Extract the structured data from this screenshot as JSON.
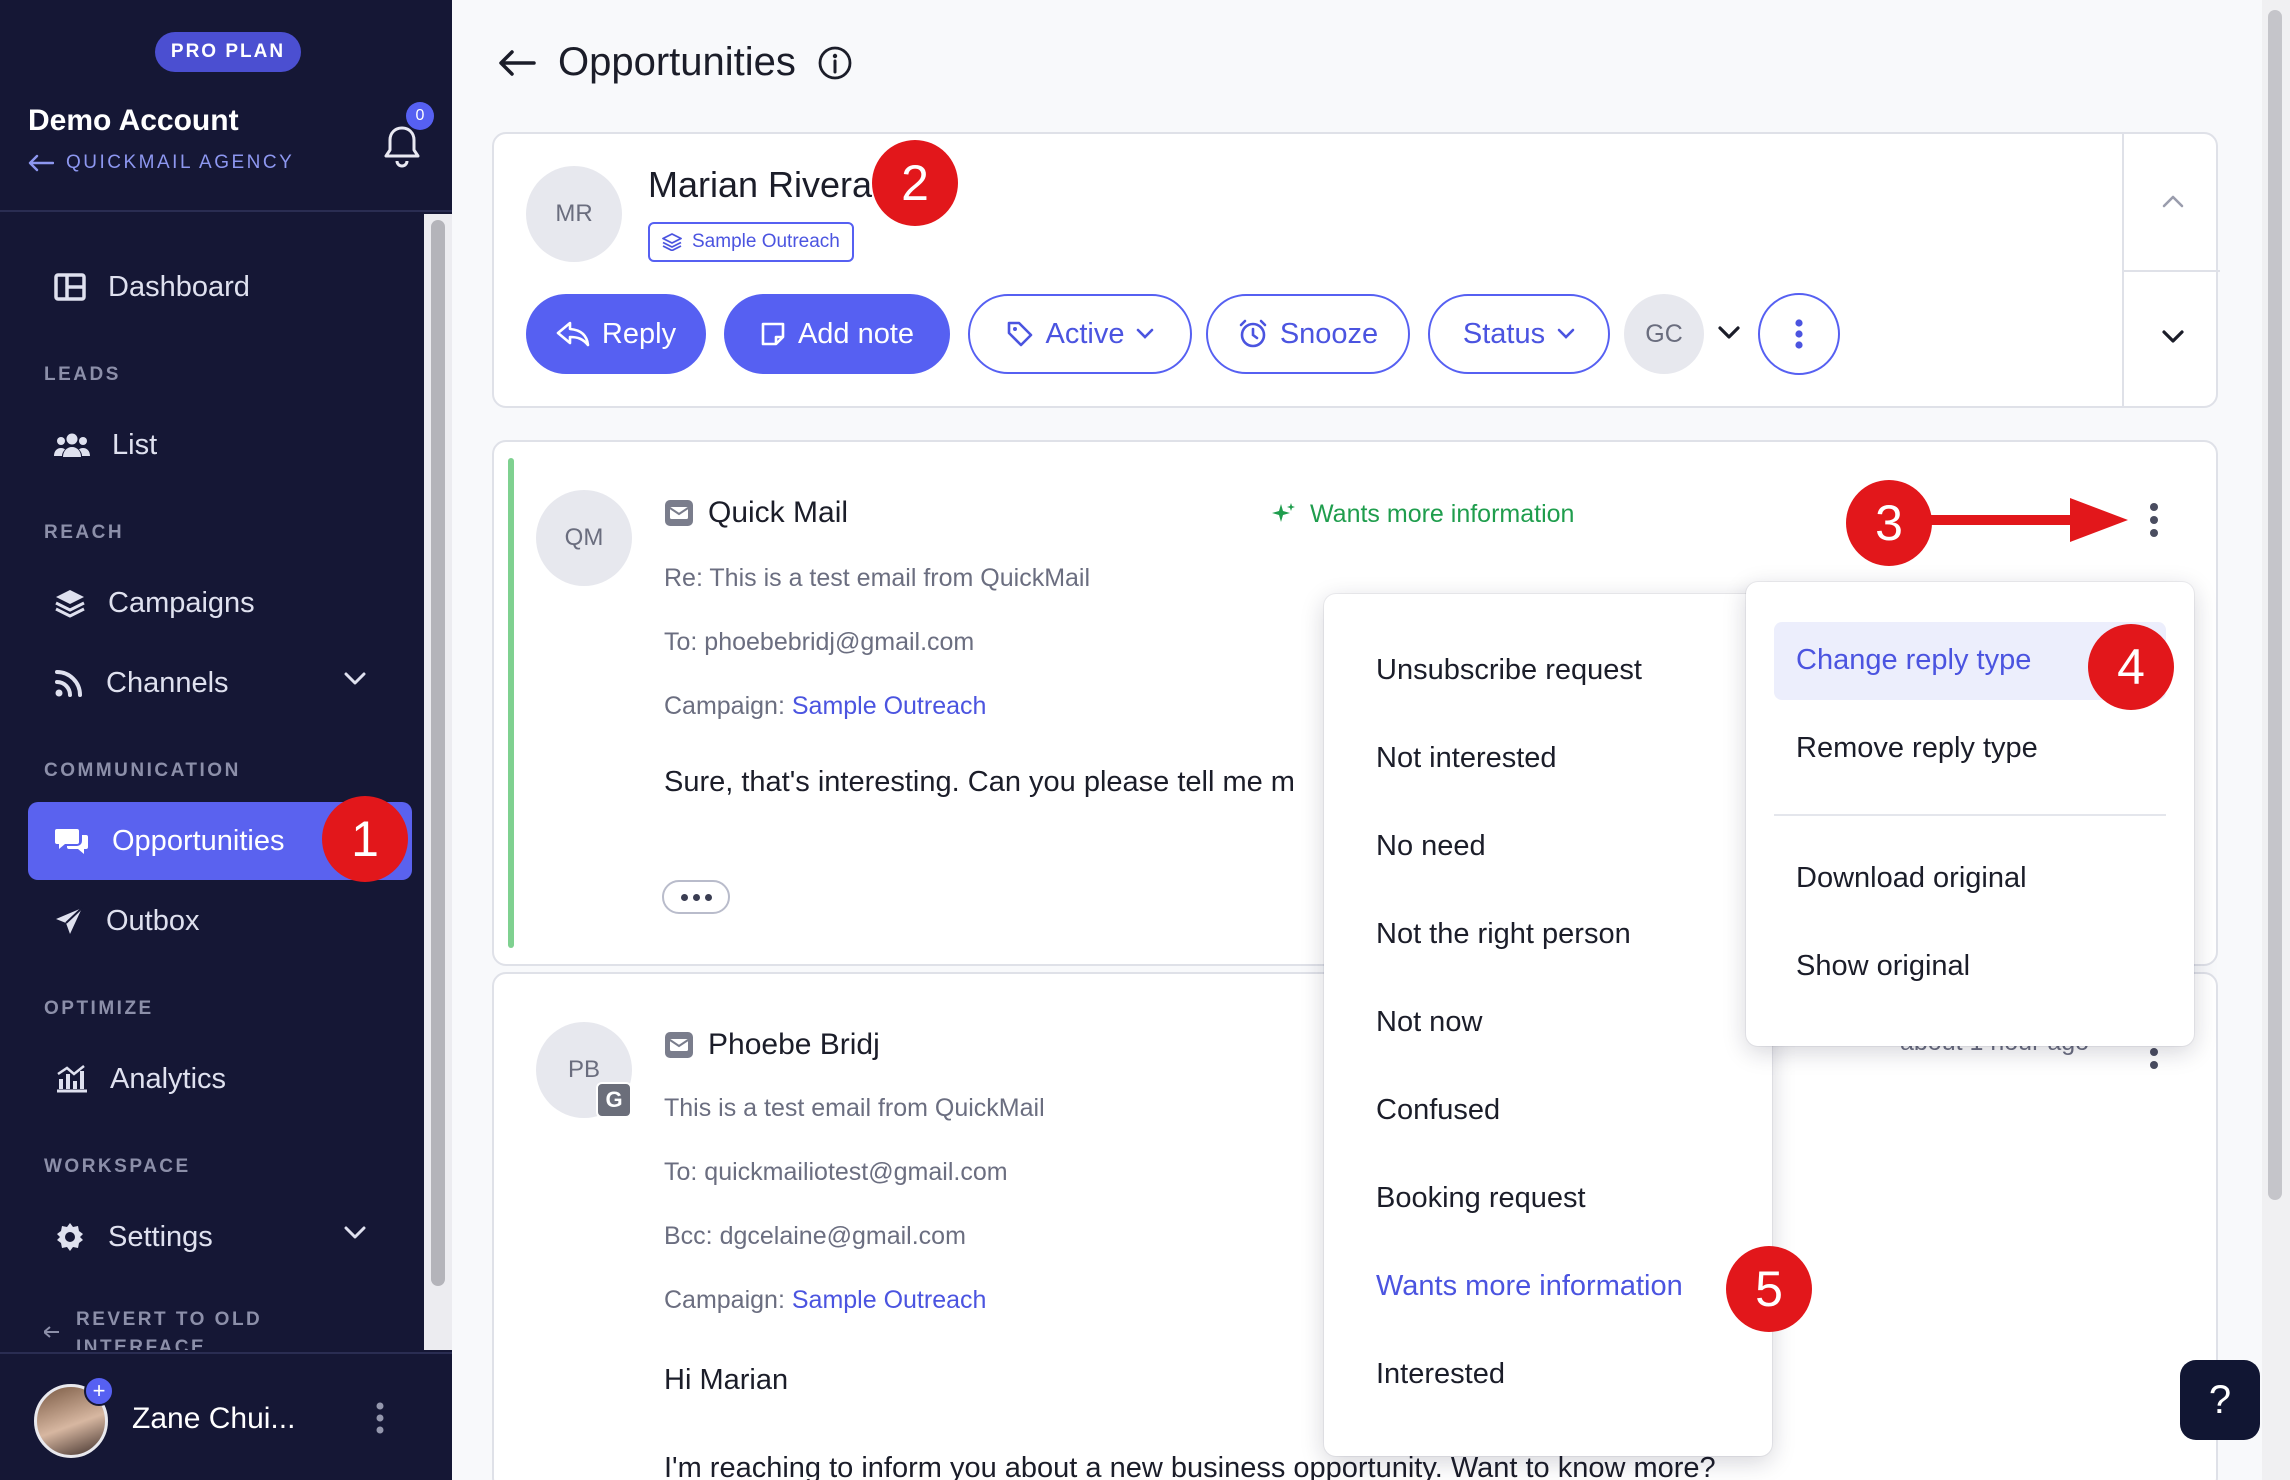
{
  "sidebar": {
    "plan": "PRO PLAN",
    "account_name": "Demo Account",
    "agency": "QUICKMAIL AGENCY",
    "notifications": "0",
    "sections": {
      "leads": "LEADS",
      "reach": "REACH",
      "communication": "COMMUNICATION",
      "optimize": "OPTIMIZE",
      "workspace": "WORKSPACE"
    },
    "items": {
      "dashboard": "Dashboard",
      "list": "List",
      "campaigns": "Campaigns",
      "channels": "Channels",
      "opportunities": "Opportunities",
      "outbox": "Outbox",
      "analytics": "Analytics",
      "settings": "Settings"
    },
    "revert": "REVERT TO OLD INTERFACE",
    "user_name": "Zane Chui..."
  },
  "header": {
    "title": "Opportunities"
  },
  "lead": {
    "initials": "MR",
    "name": "Marian Rivera",
    "campaign": "Sample Outreach",
    "actions": {
      "reply": "Reply",
      "add_note": "Add note",
      "active": "Active",
      "snooze": "Snooze",
      "status": "Status"
    },
    "assignee_initials": "GC"
  },
  "messages": [
    {
      "initials": "QM",
      "sender": "Quick Mail",
      "subject": "Re: This is a test email from QuickMail",
      "to": "To: phoebebridj@gmail.com",
      "campaign_label": "Campaign: ",
      "campaign": "Sample Outreach",
      "reply_type": "Wants more information",
      "body": "Sure, that's interesting. Can you please tell me m"
    },
    {
      "initials": "PB",
      "sender": "Phoebe Bridj",
      "subject": "This is a test email from QuickMail",
      "to": "To: quickmailiotest@gmail.com",
      "bcc": "Bcc: dgcelaine@gmail.com",
      "campaign_label": "Campaign: ",
      "campaign": "Sample Outreach",
      "time": "about 1 hour ago",
      "greeting": "Hi Marian",
      "body": "I'm reaching to inform you about a new business opportunity. Want to know more?",
      "provider_badge": "G"
    }
  ],
  "reply_types_menu": [
    "Unsubscribe request",
    "Not interested",
    "No need",
    "Not the right person",
    "Not now",
    "Confused",
    "Booking request",
    "Wants more information",
    "Interested"
  ],
  "actions_menu": {
    "change": "Change reply type",
    "remove": "Remove reply type",
    "download": "Download original",
    "show": "Show original"
  },
  "callouts": [
    "1",
    "2",
    "3",
    "4",
    "5"
  ],
  "help": "?",
  "colors": {
    "sidebar_bg": "#151735",
    "accent": "#5660f2",
    "callout": "#e2171b",
    "reply_type_green": "#1f9d4d"
  }
}
